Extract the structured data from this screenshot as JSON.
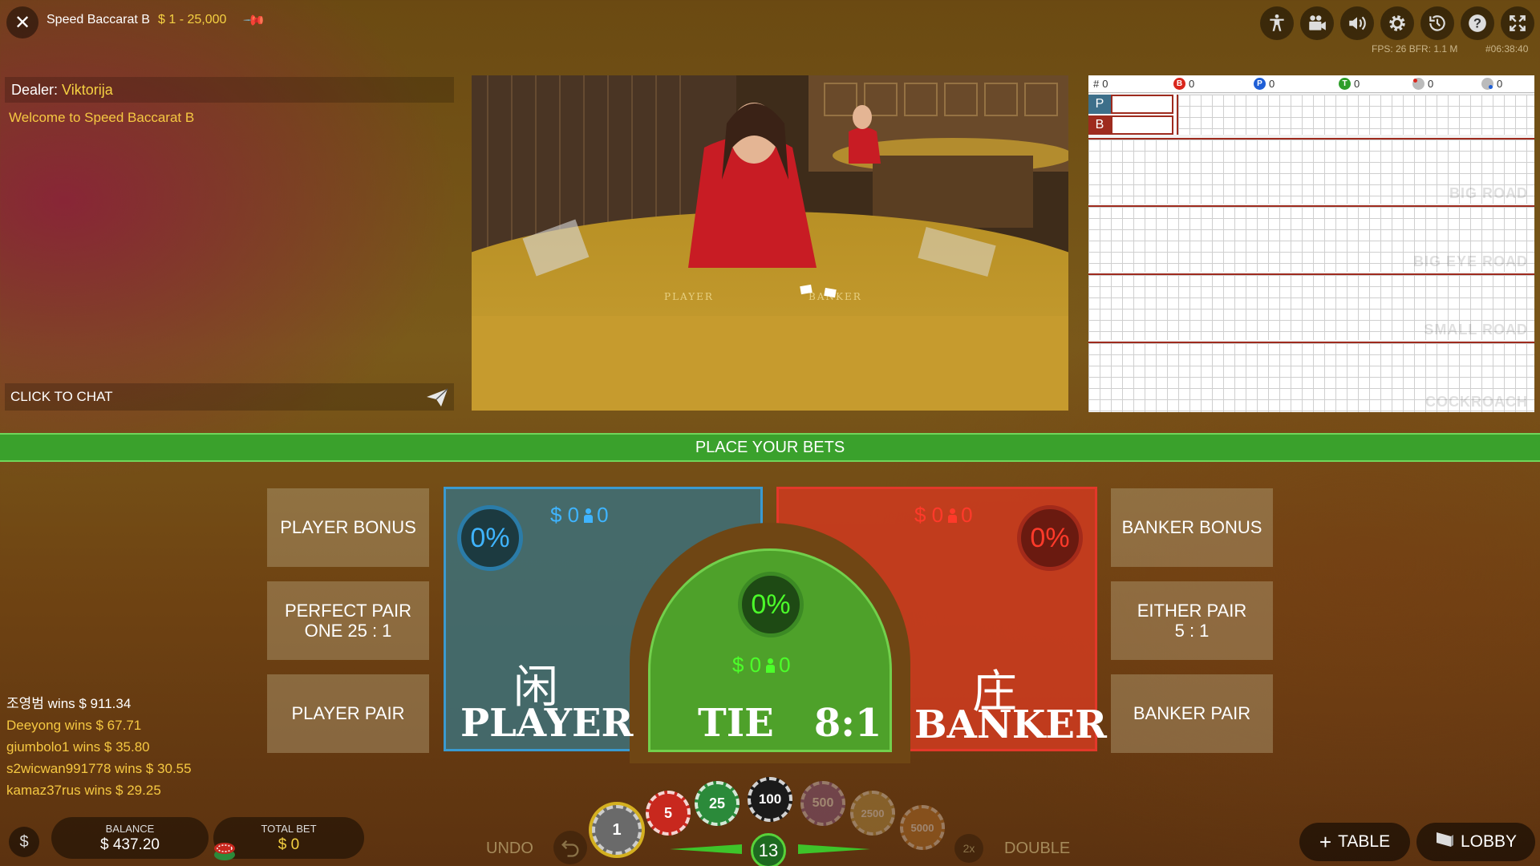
{
  "header": {
    "table_name": "Speed Baccarat B",
    "limits": "$ 1 - 25,000",
    "fps_info": "FPS: 26 BFR: 1.1   M",
    "session_time": "#06:38:40",
    "icons": [
      "accessibility-icon",
      "video-icon",
      "volume-icon",
      "settings-icon",
      "history-icon",
      "help-icon",
      "fullscreen-icon"
    ]
  },
  "chat": {
    "dealer_label": "Dealer:",
    "dealer_name": "Viktorija",
    "welcome": "Welcome to Speed Baccarat B",
    "placeholder": "CLICK TO CHAT"
  },
  "roadmap": {
    "stats": [
      {
        "key": "#",
        "value": "0"
      },
      {
        "key": "B",
        "value": "0",
        "color": "#d9261c"
      },
      {
        "key": "P",
        "value": "0",
        "color": "#1f5fd6"
      },
      {
        "key": "T",
        "value": "0",
        "color": "#2e9e2a"
      },
      {
        "key": "banker-pair",
        "value": "0"
      },
      {
        "key": "player-pair",
        "value": "0"
      }
    ],
    "row_p": "P",
    "row_b": "B",
    "roads": [
      "BIG ROAD",
      "BIG EYE ROAD",
      "SMALL ROAD",
      "COCKROACH"
    ]
  },
  "status": "PLACE YOUR BETS",
  "side_bets": {
    "player_bonus": "PLAYER BONUS",
    "perfect_pair_1": "PERFECT PAIR",
    "perfect_pair_2": "ONE 25 : 1",
    "player_pair": "PLAYER PAIR",
    "banker_bonus": "BANKER BONUS",
    "either_pair_1": "EITHER PAIR",
    "either_pair_2": "5 : 1",
    "banker_pair": "BANKER PAIR"
  },
  "main_bets": {
    "player": {
      "pct": "0%",
      "amount": "$ 0",
      "players": "0",
      "cjk": "闲",
      "label": "PLAYER"
    },
    "tie": {
      "pct": "0%",
      "amount": "$ 0",
      "players": "0",
      "label": "TIE   8:1"
    },
    "banker": {
      "pct": "0%",
      "amount": "$ 0",
      "players": "0",
      "cjk": "庄",
      "label": "BANKER"
    }
  },
  "winners": [
    "조영범 wins $ 911.34",
    "Deeyong wins $ 67.71",
    "giumbolo1 wins $ 35.80",
    "s2wicwan991778 wins $ 30.55",
    "kamaz37rus wins $ 29.25"
  ],
  "footer": {
    "balance_label": "BALANCE",
    "balance_value": "$ 437.20",
    "totalbet_label": "TOTAL BET",
    "totalbet_value": "$ 0",
    "undo": "UNDO",
    "double": "DOUBLE",
    "double_icon": "2x",
    "timer": "13",
    "chips": [
      {
        "value": "1",
        "color": "#6a6a6a"
      },
      {
        "value": "5",
        "color": "#c8281e"
      },
      {
        "value": "25",
        "color": "#2b8a3a"
      },
      {
        "value": "100",
        "color": "#1a1a1a"
      },
      {
        "value": "500",
        "color": "#8a5aa0"
      },
      {
        "value": "2500",
        "color": "#c0a050"
      },
      {
        "value": "5000",
        "color": "#c07a30"
      }
    ],
    "table_btn": "TABLE",
    "lobby_btn": "LOBBY"
  }
}
